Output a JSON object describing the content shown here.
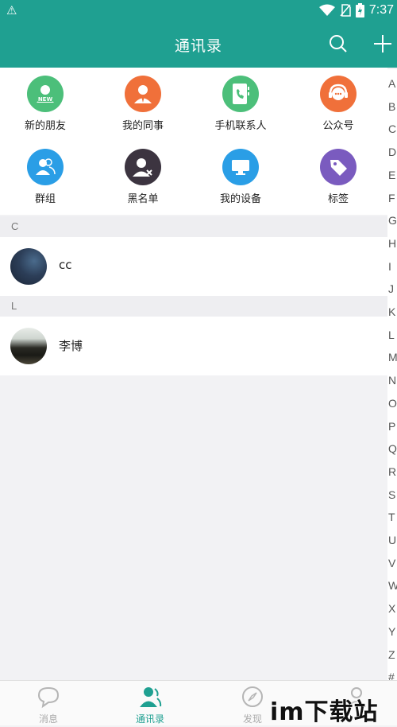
{
  "status": {
    "time": "7:37"
  },
  "header": {
    "title": "通讯录"
  },
  "quick_actions": [
    {
      "label": "新的朋友",
      "icon": "new-friend-icon",
      "color": "#4cbf7a"
    },
    {
      "label": "我的同事",
      "icon": "colleague-icon",
      "color": "#f0703a"
    },
    {
      "label": "手机联系人",
      "icon": "phone-contacts-icon",
      "color": "#4cbf7a"
    },
    {
      "label": "公众号",
      "icon": "headset-icon",
      "color": "#f0703a"
    },
    {
      "label": "群组",
      "icon": "group-icon",
      "color": "#2a9ee6"
    },
    {
      "label": "黑名单",
      "icon": "blacklist-icon",
      "color": "#3c3440"
    },
    {
      "label": "我的设备",
      "icon": "device-icon",
      "color": "#2a9ee6"
    },
    {
      "label": "标签",
      "icon": "tag-icon",
      "color": "#7a5bbf"
    }
  ],
  "contacts": {
    "sections": [
      {
        "letter": "C",
        "items": [
          {
            "name": "cc"
          }
        ]
      },
      {
        "letter": "L",
        "items": [
          {
            "name": "李博"
          }
        ]
      }
    ]
  },
  "index_letters": [
    "A",
    "B",
    "C",
    "D",
    "E",
    "F",
    "G",
    "H",
    "I",
    "J",
    "K",
    "L",
    "M",
    "N",
    "O",
    "P",
    "Q",
    "R",
    "S",
    "T",
    "U",
    "V",
    "W",
    "X",
    "Y",
    "Z",
    "#"
  ],
  "bottom_nav": {
    "tabs": [
      {
        "label": "消息",
        "icon": "chat-bubble-icon",
        "active": false
      },
      {
        "label": "通讯录",
        "icon": "contacts-icon",
        "active": true
      },
      {
        "label": "发现",
        "icon": "compass-icon",
        "active": false
      },
      {
        "label": "",
        "icon": "profile-icon",
        "active": false
      }
    ]
  },
  "watermark": "im下载站",
  "accent_color": "#1fa091"
}
